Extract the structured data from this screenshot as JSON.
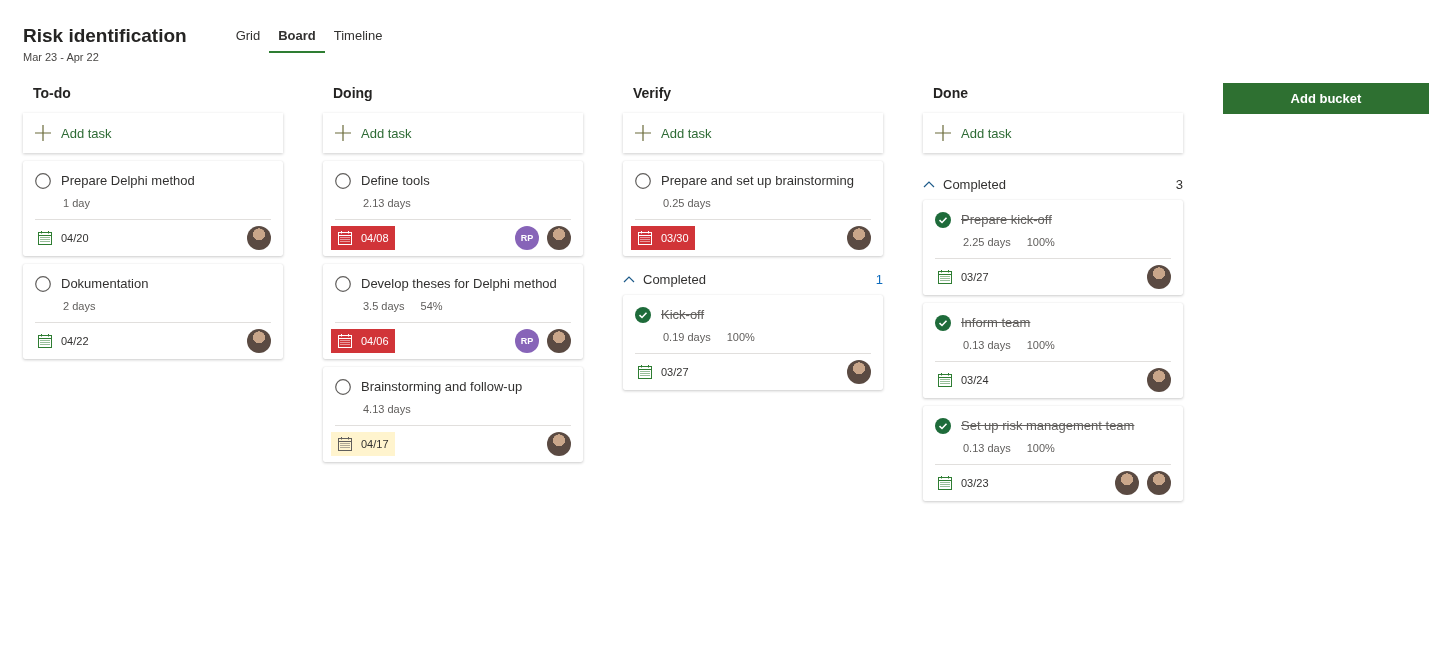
{
  "header": {
    "title": "Risk identification",
    "date_range": "Mar 23 - Apr 22"
  },
  "tabs": [
    {
      "label": "Grid",
      "selected": false
    },
    {
      "label": "Board",
      "selected": true
    },
    {
      "label": "Timeline",
      "selected": false
    }
  ],
  "buckets": [
    {
      "name": "To-do",
      "add_task": "Add task",
      "tasks": [
        {
          "title": "Prepare Delphi method",
          "completed": false,
          "duration": "1 day",
          "due": {
            "date": "04/20",
            "kind": "normal"
          },
          "assignees": [
            {
              "kind": "photo"
            }
          ]
        },
        {
          "title": "Dokumentation",
          "completed": false,
          "duration": "2 days",
          "due": {
            "date": "04/22",
            "kind": "normal"
          },
          "assignees": [
            {
              "kind": "photo"
            }
          ]
        }
      ]
    },
    {
      "name": "Doing",
      "add_task": "Add task",
      "tasks": [
        {
          "title": "Define tools",
          "completed": false,
          "duration": "2.13 days",
          "due": {
            "date": "04/08",
            "kind": "overdue"
          },
          "assignees": [
            {
              "kind": "initials",
              "initials": "RP",
              "color": "#8764b8"
            },
            {
              "kind": "photo"
            }
          ]
        },
        {
          "title": "Develop theses for Delphi method",
          "completed": false,
          "duration": "3.5 days",
          "percent_text": "54%",
          "due": {
            "date": "04/06",
            "kind": "overdue"
          },
          "assignees": [
            {
              "kind": "initials",
              "initials": "RP",
              "color": "#8764b8"
            },
            {
              "kind": "photo"
            }
          ]
        },
        {
          "title": "Brainstorming and follow-up",
          "completed": false,
          "duration": "4.13 days",
          "due": {
            "date": "04/17",
            "kind": "soon"
          },
          "assignees": [
            {
              "kind": "photo"
            }
          ]
        }
      ]
    },
    {
      "name": "Verify",
      "add_task": "Add task",
      "tasks": [
        {
          "title": "Prepare and set up brainstorming",
          "completed": false,
          "duration": "0.25 days",
          "due": {
            "date": "03/30",
            "kind": "overdue"
          },
          "assignees": [
            {
              "kind": "photo"
            }
          ]
        }
      ],
      "completed_section": {
        "label": "Completed",
        "count": "1",
        "expanded": true,
        "tasks": [
          {
            "title": "Kick-off",
            "completed": true,
            "duration": "0.19 days",
            "percent_text": "100%",
            "due": {
              "date": "03/27",
              "kind": "normal"
            },
            "assignees": [
              {
                "kind": "photo"
              }
            ]
          }
        ]
      }
    },
    {
      "name": "Done",
      "add_task": "Add task",
      "completed_section": {
        "label": "Completed",
        "count": "3",
        "expanded": true,
        "tasks": [
          {
            "title": "Prepare kick-off",
            "completed": true,
            "duration": "2.25 days",
            "percent_text": "100%",
            "due": {
              "date": "03/27",
              "kind": "normal"
            },
            "assignees": [
              {
                "kind": "photo"
              }
            ]
          },
          {
            "title": "Inform team",
            "completed": true,
            "duration": "0.13 days",
            "percent_text": "100%",
            "due": {
              "date": "03/24",
              "kind": "normal"
            },
            "assignees": [
              {
                "kind": "photo"
              }
            ]
          },
          {
            "title": "Set up risk management team",
            "completed": true,
            "duration": "0.13 days",
            "percent_text": "100%",
            "due": {
              "date": "03/23",
              "kind": "normal"
            },
            "assignees": [
              {
                "kind": "photo"
              },
              {
                "kind": "photo"
              }
            ]
          }
        ]
      }
    }
  ],
  "add_bucket": "Add bucket"
}
